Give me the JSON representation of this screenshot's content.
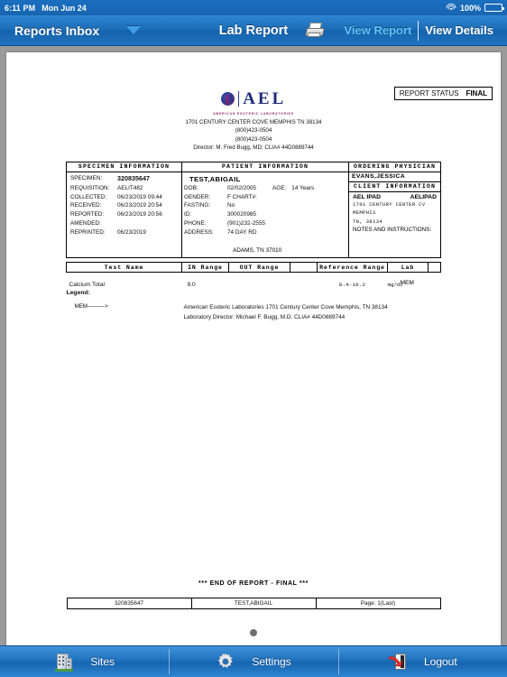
{
  "status_bar": {
    "time": "6:11 PM",
    "date": "Mon Jun 24",
    "battery_percent": "100%",
    "wifi_icon": "wifi-icon",
    "battery_icon": "battery-icon"
  },
  "navbar": {
    "back_label": "Reports Inbox",
    "dropdown_icon": "chevron-down-icon",
    "title": "Lab Report",
    "print_icon": "printer-icon",
    "segments": [
      {
        "label": "View Report",
        "active": true
      },
      {
        "label": "View Details",
        "active": false
      }
    ]
  },
  "report": {
    "logo": {
      "letters": "AEL",
      "subtitle": "AMERICAN ESOTERIC LABORATORIES",
      "mark_icon": "ael-circle-logo"
    },
    "lab_address": [
      "1701 CENTURY CENTER COVE MEMPHIS TN 38134",
      "(800)423-0504",
      "(800)423-0504",
      "Director: M. Fred Bugg, MD; CLIA# 44D0889744"
    ],
    "status_box": {
      "label": "REPORT STATUS",
      "value": "FINAL"
    },
    "specimen": {
      "header": "SPECIMEN INFORMATION",
      "rows": [
        {
          "key": "SPECIMEN:",
          "value": "320835647",
          "bold": true
        },
        {
          "key": "REQUISITION:",
          "value": "AELIT482",
          "bold": false
        },
        {
          "key": "COLLECTED:",
          "value": "06/23/2019 09:44",
          "bold": false
        },
        {
          "key": "RECEIVED:",
          "value": "06/23/2019 20:54",
          "bold": false
        },
        {
          "key": "REPORTED:",
          "value": "06/23/2019 20:56",
          "bold": false
        },
        {
          "key": "AMENDED:",
          "value": "",
          "bold": false
        },
        {
          "key": "REPRINTED:",
          "value": "06/23/2019",
          "bold": false
        }
      ]
    },
    "patient": {
      "header": "PATIENT INFORMATION",
      "name": "TEST,ABIGAIL",
      "dob_key": "DOB:",
      "dob_value": "02/02/2005",
      "age_key": "AGE:",
      "age_value": "14 Years",
      "rows": [
        {
          "key": "GENDER:",
          "value": "F      CHART#:"
        },
        {
          "key": "FASTING:",
          "value": "No"
        },
        {
          "key": "ID:",
          "value": "300020985"
        },
        {
          "key": "PHONE:",
          "value": "(901)232-2555"
        },
        {
          "key": "ADDRESS:",
          "value": "74 DAY RD"
        }
      ],
      "address_line2": "ADAMS, TN 37010"
    },
    "physician": {
      "header": "ORDERING PHYSICIAN",
      "name": "EVANS,JESSICA",
      "client_header": "CLIENT INFORMATION",
      "client_name": "AEL IPAD",
      "client_code": "AELIPAD",
      "client_address": [
        "1701 CENTURY CENTER CV",
        "MEMPHIS",
        "TN, 38134"
      ],
      "notes_label": "NOTES AND INSTRUCTIONS:"
    },
    "results_table": {
      "columns": [
        "Test Name",
        "IN Range",
        "OUT Range",
        "",
        "Reference Range",
        "Lab",
        ""
      ],
      "rows": [
        {
          "test_name": "Calcium Total",
          "in_range": "9.0",
          "out_range": "",
          "reference_range": "8.4-10.2",
          "units": "mg/dL",
          "lab": "MEM"
        }
      ]
    },
    "legend": {
      "title": "Legend:",
      "entries": [
        {
          "code": "MEM---------->",
          "lines": [
            "American Esoteric Laboratories 1701 Century Center Cove Memphis, TN 38134",
            "Laboratory Director: Michael F. Bugg, M.D. CLIA# 44D0889744"
          ]
        }
      ]
    },
    "end_of_report": "*** END OF REPORT - FINAL ***",
    "footer_row": [
      "320835647",
      "TEST,ABIGAIL",
      "Page: 1(Last)"
    ]
  },
  "page_indicator": {
    "dots": 1,
    "active": 0
  },
  "tabbar": {
    "tabs": [
      {
        "label": "Sites",
        "icon": "building-icon"
      },
      {
        "label": "Settings",
        "icon": "gear-icon"
      },
      {
        "label": "Logout",
        "icon": "logout-door-icon"
      }
    ]
  },
  "colors": {
    "nav_blue": "#1b6bb5",
    "accent_link": "#5ec3f7",
    "page_bg": "#9a9a9a"
  }
}
